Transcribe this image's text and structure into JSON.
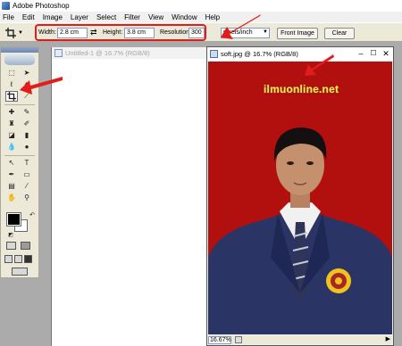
{
  "app": {
    "title": "Adobe Photoshop"
  },
  "menu": [
    "File",
    "Edit",
    "Image",
    "Layer",
    "Select",
    "Filter",
    "View",
    "Window",
    "Help"
  ],
  "options_bar": {
    "tool_icon": "crop-icon",
    "width_label": "Width:",
    "width_value": "2.8 cm",
    "height_label": "Height:",
    "height_value": "3.8 cm",
    "resolution_label": "Resolution:",
    "resolution_value": "300",
    "unit_value": "pixels/inch",
    "front_image_label": "Front Image",
    "clear_label": "Clear"
  },
  "toolbox": {
    "active_tool": "crop-icon",
    "foreground_color": "#000000",
    "background_color": "#ffffff"
  },
  "doc_untitled": {
    "title": "Untitled-1 @ 16.7% (RGB/8)"
  },
  "doc_soft": {
    "title": "soft.jpg @ 16.7% (RGB/8)",
    "watermark": "ilmuonline.net",
    "zoom": "16.67%",
    "background_color": "#b20f0f"
  },
  "annotation_color": "#e21b1b"
}
